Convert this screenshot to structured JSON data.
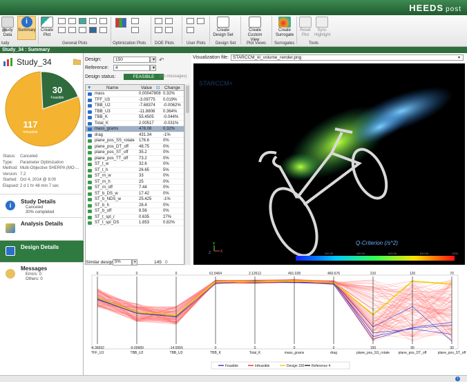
{
  "app": {
    "brand": "HEEDS",
    "brand_sub": "post"
  },
  "ribbon": {
    "study_data": "Study Data",
    "refresh": "sh",
    "summary": "Summary",
    "create_plot": "Create Plot",
    "create_design_set": "Create Design Set",
    "create_custom_view": "Create Custom View",
    "create_surrogate": "Create Surrogate",
    "reset_plot": "Reset Plot",
    "sync_highlight": "Sync Highlight",
    "groups": [
      "tudy",
      "General Plots",
      "Optimization Plots",
      "DOE Plots",
      "User Plots",
      "Design Set",
      "Plot Views",
      "Surrogates",
      "Tools"
    ]
  },
  "study_bar": "Study_34 : Summary",
  "left": {
    "study_title": "Study_34",
    "pie": {
      "feasible": 30,
      "feasible_label": "Feasible",
      "infeasible": 117,
      "infeasible_label": "Infeasible"
    },
    "meta": [
      {
        "k": "Status:",
        "v": "Canceled"
      },
      {
        "k": "Type:",
        "v": "Parameter Optimization"
      },
      {
        "k": "Method:",
        "v": "Multi-Objective SHERPA (MO-..."
      },
      {
        "k": "Version:",
        "v": "7.2"
      },
      {
        "k": "Started:",
        "v": "Oct 4, 2014 @ 8:00"
      },
      {
        "k": "Elapsed:",
        "v": "2 d 1 hr 48 min 7 sec"
      }
    ],
    "nav": {
      "study_details": "Study Details",
      "study_status": "Canceled",
      "study_pct": "30% completed",
      "analysis_details": "Analysis Details",
      "design_details": "Design Details",
      "messages": "Messages",
      "errors": "Errors: 0",
      "others": "Others: 0"
    }
  },
  "design": {
    "design_label": "Design:",
    "design_value": "150",
    "reference_label": "Reference:",
    "reference_value": "4",
    "status_label": "Design status:",
    "status_value": "FEASIBLE",
    "messages": "(no messages)"
  },
  "table": {
    "headers": {
      "name": "Name",
      "value": "Value",
      "change": "Change"
    },
    "rows": [
      {
        "name": "mass",
        "value": "0.00047808",
        "change": "0.32%",
        "kind": "resp"
      },
      {
        "name": "TFF_U3",
        "value": "-3.09775",
        "change": "0.019%",
        "kind": "resp"
      },
      {
        "name": "TBB_U2",
        "value": "-7.68374",
        "change": "-0.0062%",
        "kind": "resp"
      },
      {
        "name": "TBB_U3",
        "value": "-11.8808",
        "change": "0.364%",
        "kind": "resp"
      },
      {
        "name": "TBB_K",
        "value": "55.4505",
        "change": "-0.044%",
        "kind": "resp"
      },
      {
        "name": "Total_K",
        "value": "2.00517",
        "change": "-0.031%",
        "kind": "resp"
      },
      {
        "name": "mass_grams",
        "value": "478.08",
        "change": "0.32%",
        "kind": "resp",
        "selected": true
      },
      {
        "name": "drag",
        "value": "431.34",
        "change": "-1%",
        "kind": "resp"
      },
      {
        "name": "plane_pos_SS_rotate",
        "value": "176.6",
        "change": "0%",
        "kind": "var"
      },
      {
        "name": "plane_pos_DT_off",
        "value": "48.75",
        "change": "0%",
        "kind": "var"
      },
      {
        "name": "plane_pos_ST_off",
        "value": "35.2",
        "change": "0%",
        "kind": "var"
      },
      {
        "name": "plane_pos_TT_off",
        "value": "73.2",
        "change": "0%",
        "kind": "var"
      },
      {
        "name": "ST_t_w",
        "value": "32.6",
        "change": "0%",
        "kind": "var"
      },
      {
        "name": "ST_t_h",
        "value": "26.65",
        "change": "5%",
        "kind": "var"
      },
      {
        "name": "ST_m_w",
        "value": "33",
        "change": "0%",
        "kind": "var"
      },
      {
        "name": "ST_m_h",
        "value": "25",
        "change": "0%",
        "kind": "var"
      },
      {
        "name": "ST_m_off",
        "value": "7.44",
        "change": "0%",
        "kind": "var"
      },
      {
        "name": "ST_b_DS_w",
        "value": "17.42",
        "change": "0%",
        "kind": "var"
      },
      {
        "name": "ST_b_NDS_w",
        "value": "25.425",
        "change": "-1%",
        "kind": "var"
      },
      {
        "name": "ST_b_h",
        "value": "28.4",
        "change": "0%",
        "kind": "var"
      },
      {
        "name": "ST_b_off",
        "value": "8.56",
        "change": "0%",
        "kind": "var"
      },
      {
        "name": "ST_t_spl_r",
        "value": "0.635",
        "change": "27%",
        "kind": "var"
      },
      {
        "name": "ST_t_spl_DS",
        "value": "1.853",
        "change": "0.82%",
        "kind": "var"
      }
    ]
  },
  "viz": {
    "file_label": "Visualization file:",
    "file_value": "STARCCM_kl_volume_render.png",
    "watermark": "STARCCM+",
    "colorbar_title": "Q-Criterion (/s^2)",
    "colorbar_ticks": [
      "10.00",
      "240.00",
      "430.00",
      "620.00",
      "810.00",
      "1000."
    ],
    "axes": {
      "x": "X",
      "y": "Y",
      "z": "Z"
    }
  },
  "similar": {
    "label": "Similar designs:",
    "value": "5%",
    "count": "145",
    "of": "0"
  },
  "chart_data": {
    "type": "parallel-coordinates",
    "axes": [
      {
        "name": "TFF_U3",
        "top": "0",
        "bottom": "-4.36692"
      },
      {
        "name": "TBB_U2",
        "top": "0",
        "bottom": "-9.00689"
      },
      {
        "name": "TBB_U3",
        "top": "0",
        "bottom": "-14.5555"
      },
      {
        "name": "TBB_K",
        "top": "61.5464",
        "bottom": "0"
      },
      {
        "name": "Total_K",
        "top": "2.12612",
        "bottom": "0"
      },
      {
        "name": "mass_grams",
        "top": "491.028",
        "bottom": "0"
      },
      {
        "name": "drag",
        "top": "460.676",
        "bottom": "0"
      },
      {
        "name": "plane_pos_SS_rotate",
        "top": "210",
        "bottom": "150"
      },
      {
        "name": "plane_pos_DT_off",
        "top": "120",
        "bottom": "95"
      },
      {
        "name": "plane_pos_ST_off",
        "top": "70",
        "bottom": "30"
      }
    ],
    "legend": [
      {
        "name": "Feasible",
        "color": "#3030cc"
      },
      {
        "name": "Infeasible",
        "color": "#e03030"
      },
      {
        "name": "Design 150",
        "color": "#f2d000"
      },
      {
        "name": "Reference 4",
        "color": "#222222"
      }
    ],
    "design_150": [
      0.7,
      0.47,
      0.42,
      0.96,
      0.96,
      0.97,
      0.95,
      0.43,
      0.97,
      0.92
    ],
    "reference_4": [
      0.7,
      0.47,
      0.42,
      0.96,
      0.96,
      0.97,
      0.95,
      0.43,
      0.97,
      0.92
    ]
  }
}
